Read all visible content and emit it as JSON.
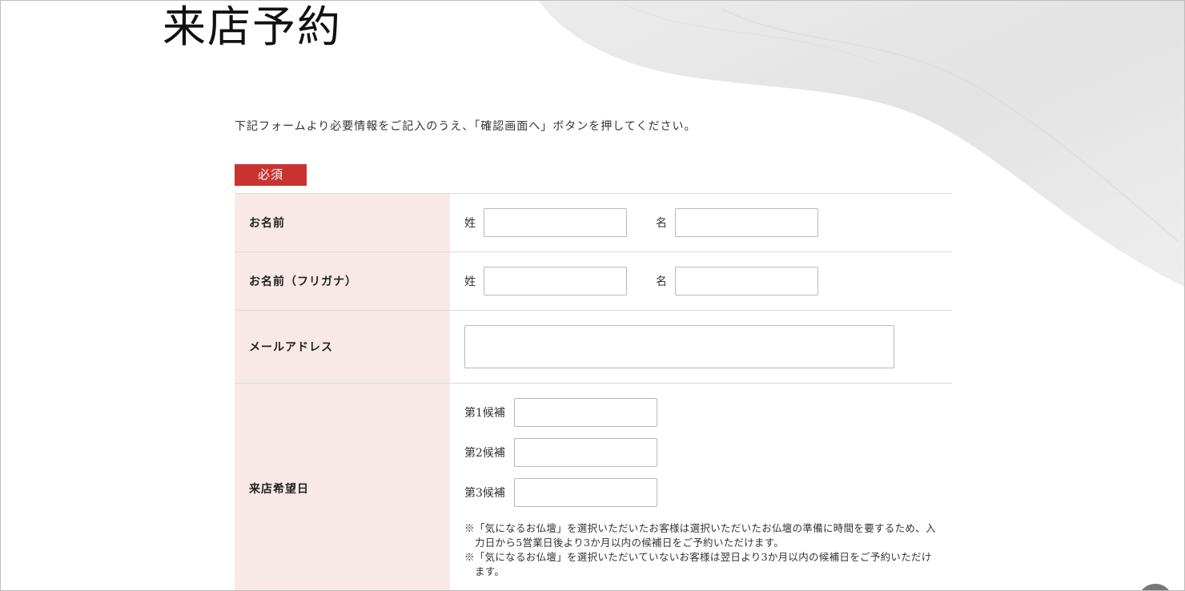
{
  "page": {
    "title": "来店予約",
    "intro": "下記フォームより必要情報をご記入のうえ、「確認画面へ」ボタンを押してください。",
    "required_badge": "必須"
  },
  "form": {
    "name": {
      "label": "お名前",
      "last_label": "姓",
      "first_label": "名",
      "last_value": "",
      "first_value": ""
    },
    "kana": {
      "label": "お名前（フリガナ）",
      "last_label": "姓",
      "first_label": "名",
      "last_value": "",
      "first_value": ""
    },
    "email": {
      "label": "メールアドレス",
      "value": ""
    },
    "visit_date": {
      "label": "来店希望日",
      "choice1_label": "第1候補",
      "choice2_label": "第2候補",
      "choice3_label": "第3候補",
      "choice1_value": "",
      "choice2_value": "",
      "choice3_value": "",
      "note1": "※「気になるお仏壇」を選択いただいたお客様は選択いただいたお仏壇の準備に時間を要するため、入力日から5営業日後より3か月以内の候補日をご予約いただけます。",
      "note2": "※「気になるお仏壇」を選択いただいていないお客様は翌日より3か月以内の候補日をご予約いただけます。"
    }
  },
  "colors": {
    "accent": "#c8332f",
    "label_bg": "#f8e9e8",
    "border": "#dcdcdc"
  },
  "icons": {
    "scroll_top": "scroll-top-icon"
  }
}
